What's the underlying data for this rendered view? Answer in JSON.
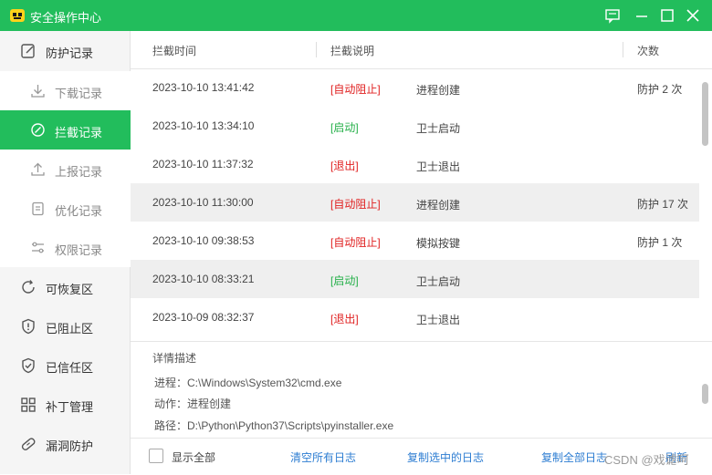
{
  "window": {
    "title": "安全操作中心",
    "accent": "#22bd5c"
  },
  "sidebar": {
    "top": [
      {
        "label": "防护记录",
        "icon": "edit-note-icon"
      }
    ],
    "sub": [
      {
        "label": "下载记录",
        "icon": "download-icon"
      },
      {
        "label": "拦截记录",
        "icon": "blocked-icon",
        "active": true
      },
      {
        "label": "上报记录",
        "icon": "upload-icon"
      },
      {
        "label": "优化记录",
        "icon": "clipboard-icon"
      },
      {
        "label": "权限记录",
        "icon": "sliders-icon"
      }
    ],
    "bottom": [
      {
        "label": "可恢复区",
        "icon": "restore-icon"
      },
      {
        "label": "已阻止区",
        "icon": "shield-alert-icon"
      },
      {
        "label": "已信任区",
        "icon": "shield-check-icon"
      },
      {
        "label": "补丁管理",
        "icon": "grid-icon"
      },
      {
        "label": "漏洞防护",
        "icon": "bandage-icon"
      }
    ]
  },
  "table": {
    "headers": [
      "拦截时间",
      "拦截说明",
      "次数"
    ],
    "rows": [
      {
        "time": "2023-10-10 13:41:42",
        "tag": "[自动阻止]",
        "tag_color": "red",
        "desc": "进程创建",
        "count": "防护 2 次",
        "highlight": false
      },
      {
        "time": "2023-10-10 13:34:10",
        "tag": "[启动]",
        "tag_color": "green",
        "desc": "卫士启动",
        "count": "",
        "highlight": false
      },
      {
        "time": "2023-10-10 11:37:32",
        "tag": "[退出]",
        "tag_color": "red",
        "desc": "卫士退出",
        "count": "",
        "highlight": false
      },
      {
        "time": "2023-10-10 11:30:00",
        "tag": "[自动阻止]",
        "tag_color": "red",
        "desc": "进程创建",
        "count": "防护 17 次",
        "highlight": true
      },
      {
        "time": "2023-10-10 09:38:53",
        "tag": "[自动阻止]",
        "tag_color": "red",
        "desc": "模拟按键",
        "count": "防护 1 次",
        "highlight": false
      },
      {
        "time": "2023-10-10 08:33:21",
        "tag": "[启动]",
        "tag_color": "green",
        "desc": "卫士启动",
        "count": "",
        "highlight": true
      },
      {
        "time": "2023-10-09 08:32:37",
        "tag": "[退出]",
        "tag_color": "red",
        "desc": "卫士退出",
        "count": "",
        "highlight": false
      }
    ]
  },
  "details": {
    "heading": "详情描述",
    "lines": [
      "进程：C:\\Windows\\System32\\cmd.exe",
      "动作：进程创建",
      "路径：D:\\Python\\Python37\\Scripts\\pyinstaller.exe"
    ]
  },
  "footer": {
    "show_all": "显示全部",
    "clear_all": "清空所有日志",
    "copy_selected": "复制选中的日志",
    "copy_all": "复制全部日志",
    "refresh": "刷新"
  },
  "watermark": "CSDN @戏谑呵"
}
